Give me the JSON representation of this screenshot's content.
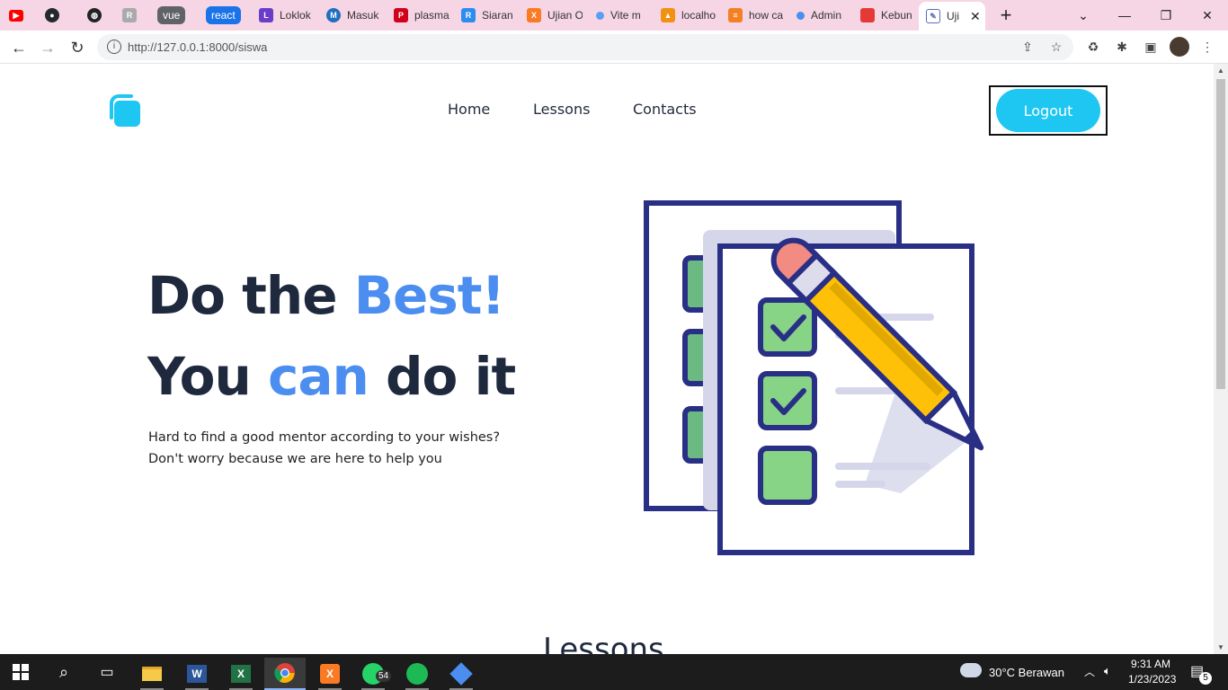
{
  "browser": {
    "tabs": [
      {
        "label": "",
        "icon": "youtube-icon",
        "color": "#ff0000"
      },
      {
        "label": "",
        "icon": "github-icon",
        "color": "#24292e"
      },
      {
        "label": "",
        "icon": "globe-icon",
        "color": "#222"
      },
      {
        "label": "",
        "icon": "retool-icon",
        "color": "#888"
      },
      {
        "label": "vue",
        "icon": "group-pill",
        "color": "#5f6368"
      },
      {
        "label": "react",
        "icon": "group-pill",
        "color": "#1a73e8"
      },
      {
        "label": "Loklok",
        "icon": "loklok-icon",
        "color": "#6a3cc9"
      },
      {
        "label": "Masuk",
        "icon": "masuk-icon",
        "color": "#1f6fbf"
      },
      {
        "label": "plasma",
        "icon": "plasma-icon",
        "color": "#d0021b"
      },
      {
        "label": "Siaran",
        "icon": "siaran-icon",
        "color": "#2d8cf0"
      },
      {
        "label": "Ujian O",
        "icon": "xampp-icon",
        "color": "#fb7a24"
      },
      {
        "label": "Vite m",
        "icon": "vite-icon",
        "color": "#5b9cf5"
      },
      {
        "label": "localho",
        "icon": "phpmyadmin-icon",
        "color": "#f29111"
      },
      {
        "label": "how ca",
        "icon": "stackoverflow-icon",
        "color": "#f48024"
      },
      {
        "label": "Admin",
        "icon": "admin-icon",
        "color": "#4b8ef0"
      },
      {
        "label": "Kebun",
        "icon": "kebun-icon",
        "color": "#e53935"
      },
      {
        "label": "Uji",
        "icon": "notepad-icon",
        "color": "#5c6bc0"
      }
    ],
    "new_tab": "+",
    "url": "http://127.0.0.1:8000/siswa"
  },
  "page": {
    "nav": {
      "home": "Home",
      "lessons": "Lessons",
      "contacts": "Contacts"
    },
    "logout": "Logout",
    "hero": {
      "line1_a": "Do the ",
      "line1_b": "Best!",
      "line2_a": "You ",
      "line2_b": "can",
      "line2_c": " do it",
      "sub1": "Hard to find a good mentor according to your wishes?",
      "sub2": "Don't worry because we are here to help you"
    },
    "section_title": "Lessons"
  },
  "taskbar": {
    "apps": [
      "windows-start-icon",
      "search-icon",
      "task-view-icon",
      "file-explorer-icon",
      "word-icon",
      "excel-icon",
      "chrome-icon",
      "xampp-icon",
      "whatsapp-icon",
      "spotify-icon",
      "git-icon"
    ],
    "whatsapp_badge": "54",
    "weather": "30°C  Berawan",
    "time": "9:31 AM",
    "date": "1/23/2023",
    "notification_count": "5"
  },
  "colors": {
    "accent": "#4b8ef0",
    "button": "#1ec6f2",
    "heading": "#1e293d",
    "tabstrip": "#f6d6e4"
  }
}
